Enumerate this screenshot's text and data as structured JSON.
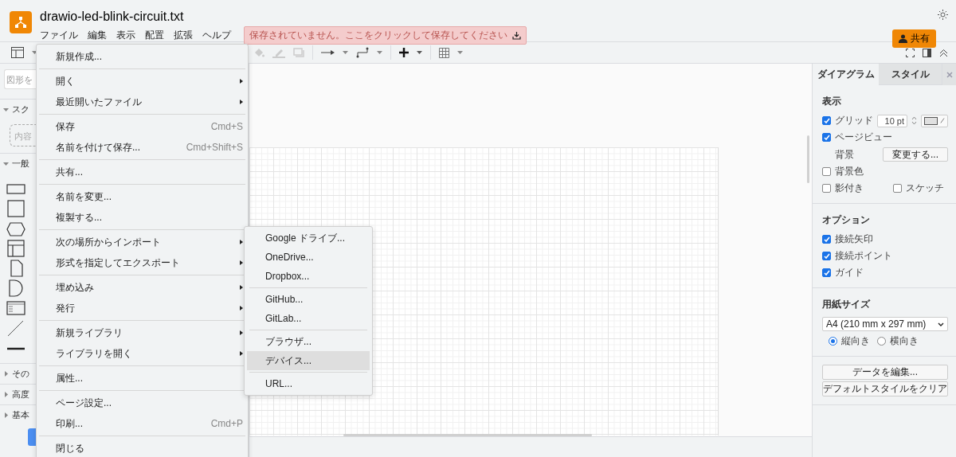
{
  "app": {
    "title": "drawio-led-blink-circuit.txt"
  },
  "menubar": [
    "ファイル",
    "編集",
    "表示",
    "配置",
    "拡張",
    "ヘルプ"
  ],
  "unsaved_banner": {
    "text": "保存されていません。ここをクリックして保存してください"
  },
  "share_button": {
    "label": "共有"
  },
  "sidebar": {
    "search": {
      "placeholder": "図形を"
    },
    "sections": [
      {
        "label": "スク",
        "expanded": true,
        "kind": "scratchpad",
        "hint": "内容"
      },
      {
        "label": "一般",
        "expanded": true,
        "kind": "shapes"
      },
      {
        "label": "その",
        "expanded": false
      },
      {
        "label": "高度",
        "expanded": false
      },
      {
        "label": "基本",
        "expanded": false
      }
    ]
  },
  "file_menu": {
    "groups": [
      [
        {
          "label": "新規作成...",
          "submenu": false
        }
      ],
      [
        {
          "label": "開く",
          "submenu": true
        },
        {
          "label": "最近開いたファイル",
          "submenu": true
        }
      ],
      [
        {
          "label": "保存",
          "shortcut": "Cmd+S",
          "submenu": false
        },
        {
          "label": "名前を付けて保存...",
          "shortcut": "Cmd+Shift+S",
          "submenu": false
        }
      ],
      [
        {
          "label": "共有...",
          "submenu": false
        }
      ],
      [
        {
          "label": "名前を変更...",
          "submenu": false
        },
        {
          "label": "複製する...",
          "submenu": false
        }
      ],
      [
        {
          "label": "次の場所からインポート",
          "submenu": true
        },
        {
          "label": "形式を指定してエクスポート",
          "submenu": true
        }
      ],
      [
        {
          "label": "埋め込み",
          "submenu": true
        },
        {
          "label": "発行",
          "submenu": true
        }
      ],
      [
        {
          "label": "新規ライブラリ",
          "submenu": true
        },
        {
          "label": "ライブラリを開く",
          "submenu": true
        }
      ],
      [
        {
          "label": "属性...",
          "submenu": false
        }
      ],
      [
        {
          "label": "ページ設定...",
          "submenu": false
        },
        {
          "label": "印刷...",
          "shortcut": "Cmd+P",
          "submenu": false
        }
      ],
      [
        {
          "label": "閉じる",
          "submenu": false
        }
      ]
    ]
  },
  "import_submenu": {
    "groups": [
      [
        {
          "label": "Google ドライブ...",
          "selected": false
        },
        {
          "label": "OneDrive...",
          "selected": false
        },
        {
          "label": "Dropbox...",
          "selected": false
        }
      ],
      [
        {
          "label": "GitHub...",
          "selected": false
        },
        {
          "label": "GitLab...",
          "selected": false
        }
      ],
      [
        {
          "label": "ブラウザ...",
          "selected": false
        },
        {
          "label": "デバイス...",
          "selected": true
        }
      ],
      [
        {
          "label": "URL...",
          "selected": false
        }
      ]
    ]
  },
  "format_panel": {
    "tabs": [
      {
        "label": "ダイアグラム",
        "selected": true
      },
      {
        "label": "スタイル",
        "selected": false
      }
    ],
    "view": {
      "title": "表示",
      "grid": {
        "label": "グリッド",
        "checked": true,
        "value": "10 pt"
      },
      "page_view": {
        "label": "ページビュー",
        "checked": true
      },
      "background": {
        "label": "背景",
        "button": "変更する..."
      },
      "background_color": {
        "label": "背景色",
        "checked": false
      },
      "shadow": {
        "label": "影付き",
        "checked": false
      },
      "sketch": {
        "label": "スケッチ",
        "checked": false
      }
    },
    "options": {
      "title": "オプション",
      "items": [
        {
          "label": "接続矢印",
          "checked": true
        },
        {
          "label": "接続ポイント",
          "checked": true
        },
        {
          "label": "ガイド",
          "checked": true
        }
      ]
    },
    "paper": {
      "title": "用紙サイズ",
      "value": "A4 (210 mm x 297 mm)",
      "orientations": [
        {
          "label": "縦向き",
          "selected": true
        },
        {
          "label": "横向き",
          "selected": false
        }
      ]
    },
    "buttons": [
      "データを編集...",
      "デフォルトスタイルをクリア"
    ]
  }
}
